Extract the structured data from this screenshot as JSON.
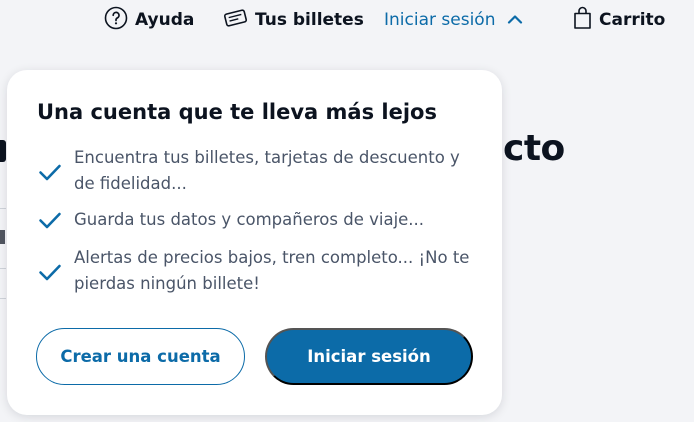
{
  "nav": {
    "help_label": "Ayuda",
    "tickets_label": "Tus billetes",
    "login_label": "Iniciar sesión",
    "cart_label": "Carrito"
  },
  "background": {
    "heading_fragment": "cto"
  },
  "panel": {
    "title": "Una cuenta que te lleva más lejos",
    "benefits": [
      "Encuentra tus billetes, tarjetas de descuento y de fidelidad...",
      "Guarda tus datos y compañeros de viaje...",
      "Alertas de precios bajos, tren completo... ¡No te pierdas ningún billete!"
    ],
    "create_account_label": "Crear una cuenta",
    "login_button_label": "Iniciar sesión"
  },
  "colors": {
    "accent": "#0c6ba8",
    "text_dark": "#0c131f",
    "text_muted": "#4a5568",
    "page_bg": "#f3f4f7"
  },
  "icons": {
    "help": "question-circle-icon",
    "tickets": "ticket-icon",
    "login_chevron": "chevron-up-icon",
    "cart": "shopping-bag-icon",
    "benefit": "check-icon"
  }
}
